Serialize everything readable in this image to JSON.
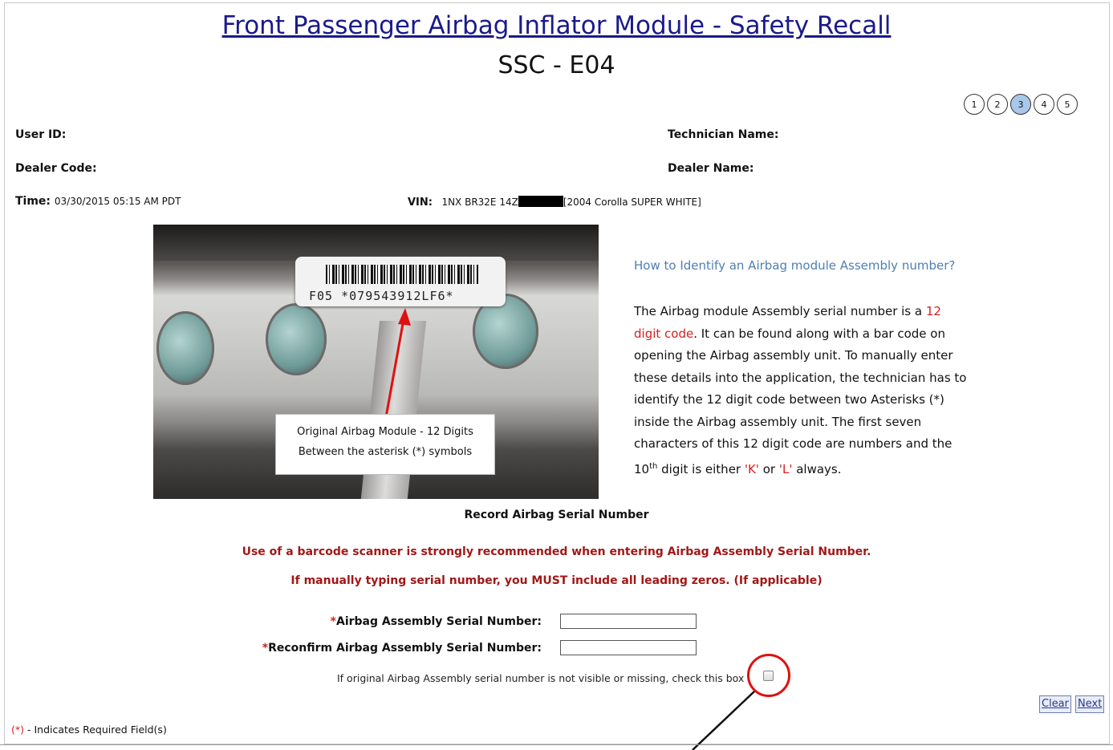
{
  "header": {
    "title": "Front Passenger Airbag Inflator Module - Safety Recall",
    "subtitle": "SSC - E04"
  },
  "steps": [
    {
      "label": "1",
      "active": false
    },
    {
      "label": "2",
      "active": false
    },
    {
      "label": "3",
      "active": true
    },
    {
      "label": "4",
      "active": false
    },
    {
      "label": "5",
      "active": false
    }
  ],
  "info": {
    "user_id_label": "User ID:",
    "dealer_code_label": "Dealer Code:",
    "time_label": "Time:",
    "time_value": "03/30/2015 05:15 AM PDT",
    "technician_name_label": "Technician Name:",
    "dealer_name_label": "Dealer Name:",
    "vin_label": "VIN:",
    "vin_value": "1NX BR32E 14Z",
    "vin_vehicle": "[2004 Corolla SUPER WHITE]"
  },
  "photo": {
    "code_text": "F05  *079543912LF6*",
    "callout_line1": "Original Airbag Module - 12 Digits",
    "callout_line2": "Between the asterisk (*) symbols"
  },
  "howto": {
    "title": "How to Identify an Airbag module Assembly number?",
    "p1": "The Airbag module Assembly serial number is a ",
    "p1_red": "12 digit code",
    "p2": ". It can be found along with a bar code on opening the Airbag assembly unit. To manually enter these details into the application, the technician has to identify the 12 digit code between two Asterisks (*) inside the Airbag assembly unit. The first seven characters of this 12 digit code are numbers and the 10",
    "sup": "th",
    "p3": " digit is either ",
    "k": "'K'",
    "or": " or ",
    "l": "'L'",
    "p4": " always."
  },
  "form": {
    "section_title": "Record Airbag Serial Number",
    "warning1": "Use of a barcode scanner is strongly recommended when entering Airbag Assembly Serial Number.",
    "warning2": "If manually typing serial number, you MUST include all leading zeros. (If applicable)",
    "required_mark": "*",
    "serial_label": "Airbag Assembly Serial Number:",
    "reconfirm_label": "Reconfirm Airbag Assembly Serial Number:",
    "serial_value": "",
    "reconfirm_value": "",
    "missing_checkbox_label": "If original Airbag Assembly serial number is not visible or missing, check this box",
    "clear_button": "Clear",
    "next_button": "Next"
  },
  "footer": {
    "required_mark": "(*)",
    "note": " - Indicates Required Field(s)"
  },
  "colors": {
    "title_blue": "#1a1a8c",
    "warning_red": "#a01818",
    "highlight_red": "#d42020",
    "active_step": "#a9c7ea",
    "howto_blue": "#4f7fb3"
  }
}
